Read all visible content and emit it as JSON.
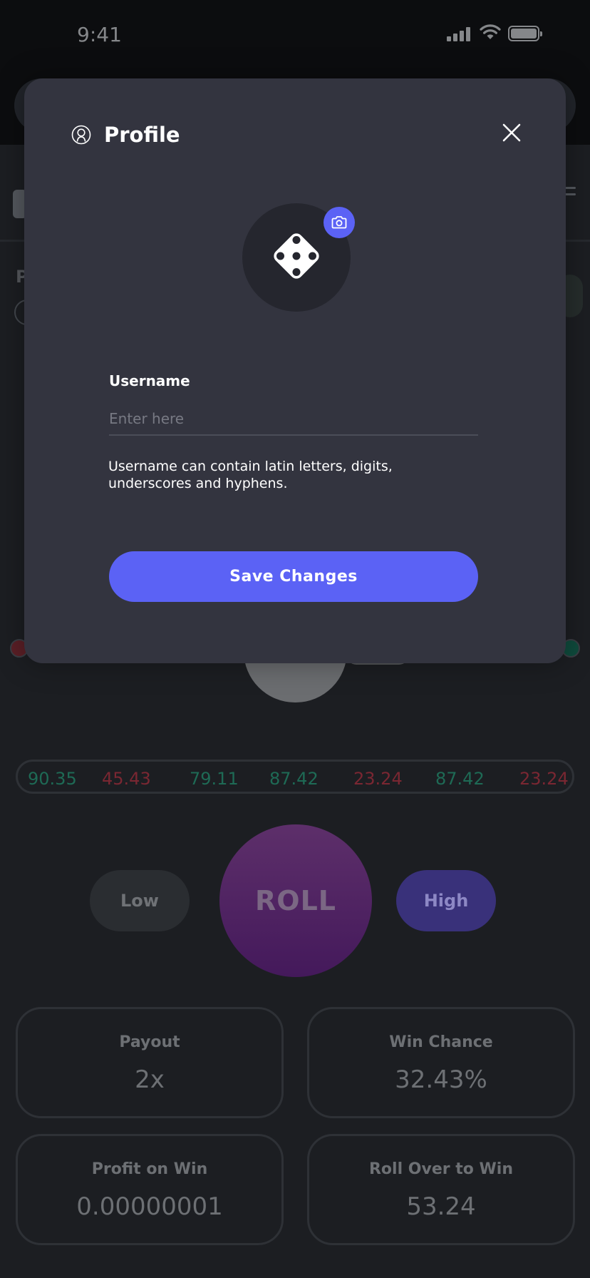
{
  "status_bar": {
    "time": "9:41"
  },
  "modal": {
    "title": "Profile",
    "username_label": "Username",
    "username_placeholder": "Enter here",
    "username_value": "",
    "helper_text": "Username can contain latin letters, digits, underscores and hyphens.",
    "save_label": "Save Changes"
  },
  "background": {
    "partial_letter": "P",
    "history": [
      {
        "value": "90.35",
        "status": "win"
      },
      {
        "value": "45.43",
        "status": "loss"
      },
      {
        "value": "79.11",
        "status": "win"
      },
      {
        "value": "87.42",
        "status": "win"
      },
      {
        "value": "23.24",
        "status": "loss"
      },
      {
        "value": "87.42",
        "status": "win"
      },
      {
        "value": "23.24",
        "status": "loss"
      }
    ],
    "low_label": "Low",
    "roll_label": "ROLL",
    "high_label": "High",
    "stats": [
      {
        "label": "Payout",
        "value": "2x"
      },
      {
        "label": "Win Chance",
        "value": "32.43%"
      },
      {
        "label": "Profit on Win",
        "value": "0.00000001"
      },
      {
        "label": "Roll Over to Win",
        "value": "53.24"
      }
    ]
  },
  "icons": {
    "profile": "user-circle-icon",
    "close": "close-icon",
    "avatar": "dice-five-icon",
    "camera": "camera-icon"
  },
  "colors": {
    "accent": "#5b62f5",
    "modal_bg": "#33343f",
    "win": "#1e6a55",
    "loss": "#7a2732"
  }
}
